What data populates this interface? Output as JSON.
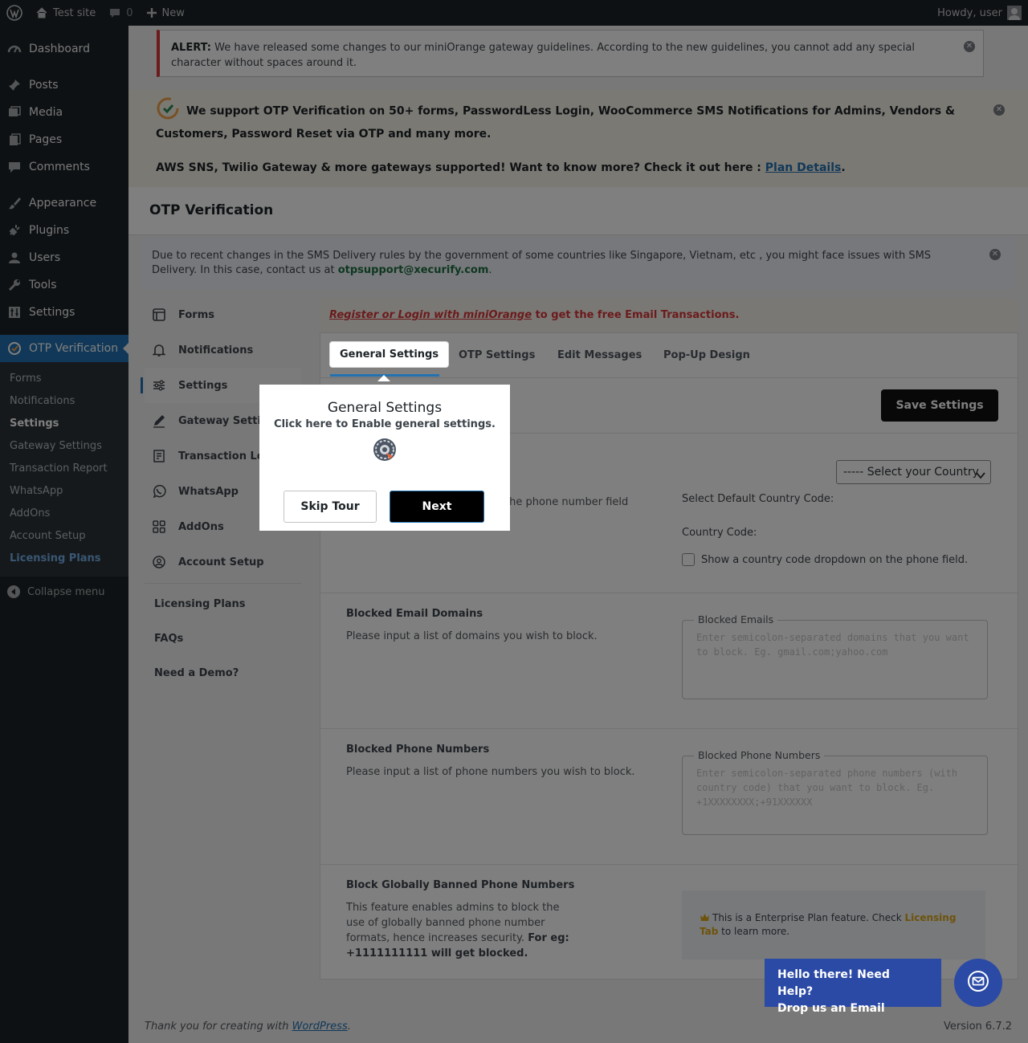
{
  "adminbar": {
    "site_name": "Test site",
    "comments_count": "0",
    "new_label": "New",
    "howdy": "Howdy, user"
  },
  "sidebar": {
    "items": [
      {
        "label": "Dashboard",
        "icon": "dashboard-icon"
      },
      {
        "label": "Posts",
        "icon": "pin-icon"
      },
      {
        "label": "Media",
        "icon": "media-icon"
      },
      {
        "label": "Pages",
        "icon": "pages-icon"
      },
      {
        "label": "Comments",
        "icon": "comment-icon"
      },
      {
        "label": "Appearance",
        "icon": "brush-icon"
      },
      {
        "label": "Plugins",
        "icon": "plug-icon"
      },
      {
        "label": "Users",
        "icon": "user-icon"
      },
      {
        "label": "Tools",
        "icon": "wrench-icon"
      },
      {
        "label": "Settings",
        "icon": "settings-icon"
      },
      {
        "label": "OTP Verification",
        "icon": "otp-logo-icon"
      }
    ],
    "submenu": [
      "Forms",
      "Notifications",
      "Settings",
      "Gateway Settings",
      "Transaction Report",
      "WhatsApp",
      "AddOns",
      "Account Setup",
      "Licensing Plans"
    ],
    "collapse": "Collapse menu"
  },
  "alert": {
    "strong": "ALERT:",
    "text": " We have released some changes to our miniOrange gateway guidelines. According to the new guidelines, you cannot add any special character without spaces around it."
  },
  "promo": {
    "line1": "We support OTP Verification on 50+ forms, PasswordLess Login, WooCommerce SMS Notifications for Admins, Vendors & Customers, Password Reset via OTP and many more.",
    "line2": "AWS SNS, Twilio Gateway & more gateways supported! Want to know more? Check it out here : ",
    "link": "Plan Details",
    "period": "."
  },
  "page_title": "OTP Verification",
  "delivery_note": {
    "text": "Due to recent changes in the SMS Delivery rules by the government of some countries like Singapore, Vietnam, etc , you might face issues with SMS Delivery. In this case, contact us at ",
    "email": "otpsupport@xecurify.com",
    "end": "."
  },
  "plugin_nav": {
    "items": [
      {
        "label": "Forms",
        "icon": "forms-icon"
      },
      {
        "label": "Notifications",
        "icon": "bell-icon"
      },
      {
        "label": "Settings",
        "icon": "sliders-icon"
      },
      {
        "label": "Gateway Settings",
        "icon": "pen-icon"
      },
      {
        "label": "Transaction Logs",
        "icon": "receipt-icon"
      },
      {
        "label": "WhatsApp",
        "icon": "whatsapp-icon"
      },
      {
        "label": "AddOns",
        "icon": "grid-icon"
      },
      {
        "label": "Account Setup",
        "icon": "account-icon"
      }
    ],
    "links": [
      "Licensing Plans",
      "FAQs",
      "Need a Demo?"
    ]
  },
  "register": {
    "link": "Register or Login with miniOrange",
    "rest": " to get the free Email Transactions."
  },
  "tabs": [
    "General Settings",
    "OTP Settings",
    "Edit Messages",
    "Pop-Up Design"
  ],
  "save_button": "Save Settings",
  "country": {
    "partial_desc": "o the phone number field",
    "default_label": "Select Default Country Code:",
    "select_value": "----- Select your Country",
    "code_label": "Country Code:",
    "checkbox_label": "Show a country code dropdown on the phone field."
  },
  "blocked_email": {
    "title": "Blocked Email Domains",
    "desc": "Please input a list of domains you wish to block.",
    "legend": "Blocked Emails",
    "placeholder": "Enter semicolon-separated domains that you want to block. Eg. gmail.com;yahoo.com"
  },
  "blocked_phone": {
    "title": "Blocked Phone Numbers",
    "desc": "Please input a list of phone numbers you wish to block.",
    "legend": "Blocked Phone Numbers",
    "placeholder": "Enter semicolon-separated phone numbers (with country code) that you want to block. Eg. +1XXXXXXXX;+91XXXXXX"
  },
  "global_ban": {
    "title": "Block Globally Banned Phone Numbers",
    "desc": "This feature enables admins to block the use of globally banned phone number formats, hence increases security. ",
    "desc_bold": "For eg: +1111111111 will get blocked.",
    "enterprise_text": "This is a Enterprise Plan feature. Check ",
    "enterprise_link": "Licensing Tab",
    "enterprise_end": " to learn more."
  },
  "tour": {
    "title": "General Settings",
    "subtitle": "Click here to Enable general settings.",
    "skip": "Skip Tour",
    "next": "Next"
  },
  "help": {
    "line1": "Hello there! Need Help?",
    "line2": "Drop us an Email"
  },
  "footer": {
    "thanks": "Thank you for creating with ",
    "wp_link": "WordPress",
    "end": ".",
    "version": "Version 6.7.2"
  },
  "colors": {
    "sidebar_bg": "#1d2327",
    "accent": "#2271b1",
    "alert_red": "#d63638",
    "help_blue": "#2b4aa5"
  }
}
